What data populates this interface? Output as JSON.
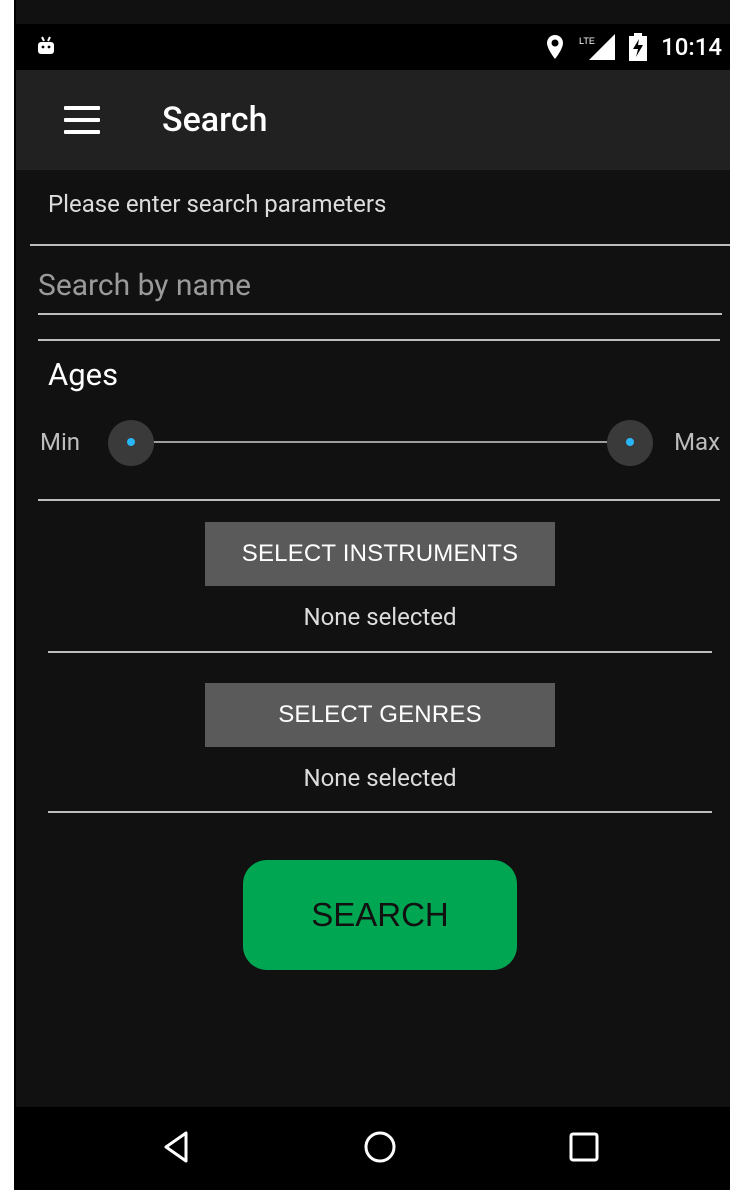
{
  "status_bar": {
    "time": "10:14",
    "left_icon": "android-robot-icon",
    "icons": [
      "location-pin-icon",
      "lte-signal-icon",
      "battery-charging-icon"
    ]
  },
  "app_bar": {
    "menu_icon": "hamburger-menu-icon",
    "title": "Search"
  },
  "form": {
    "subheading": "Please enter search parameters",
    "search_name": {
      "placeholder": "Search by name",
      "value": ""
    },
    "ages": {
      "label": "Ages",
      "min_label": "Min",
      "max_label": "Max"
    },
    "instruments": {
      "button_label": "SELECT INSTRUMENTS",
      "selected_text": "None selected"
    },
    "genres": {
      "button_label": "SELECT GENRES",
      "selected_text": "None selected"
    },
    "search_button_label": "SEARCH"
  },
  "colors": {
    "background": "#111111",
    "app_bar": "#212121",
    "select_button": "#5a5a5a",
    "search_button": "#00a651",
    "slider_accent": "#29b6f6"
  },
  "nav_bar": {
    "back_icon": "back-triangle-icon",
    "home_icon": "home-circle-icon",
    "recents_icon": "recents-square-icon"
  }
}
